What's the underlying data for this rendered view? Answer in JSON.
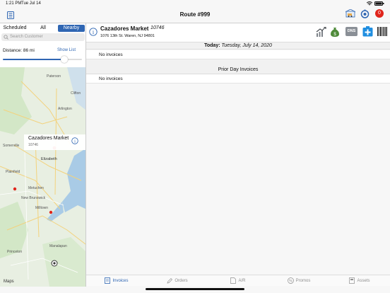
{
  "status": {
    "time": "1:21 PM",
    "date": "Tue Jul 14"
  },
  "navbar": {
    "title": "Route #999",
    "badge_count": "0"
  },
  "left": {
    "segments": [
      "Scheduled",
      "All",
      "Nearby"
    ],
    "active_segment": "Nearby",
    "search_placeholder": "Search Customer",
    "distance_label": "Distance: 86 mi",
    "show_list": "Show List",
    "slider_fraction": 0.78,
    "map": {
      "cities": [
        "Paterson",
        "Clifton",
        "Arlington",
        "Elizabeth",
        "Plainfield",
        "Metuchen",
        "New Brunswick",
        "Milltown",
        "Manalapan",
        "Princeton",
        "Somerville"
      ],
      "callout_title": "Cazadores Market",
      "callout_sub": "10746",
      "brand": "Maps"
    }
  },
  "customer": {
    "name": "Cazadores Market",
    "number": "10746",
    "address": "1076  13th St. Waren, NJ 94801",
    "dns_label": "DNS"
  },
  "today": {
    "label": "Today:",
    "date": "Tuesday, July 14, 2020",
    "empty": "No invoices"
  },
  "prior": {
    "label": "Prior Day Invoices",
    "empty": "No invoices"
  },
  "tabs": [
    {
      "label": "Invoices",
      "icon": "invoice-icon",
      "active": true
    },
    {
      "label": "Orders",
      "icon": "pencil-icon",
      "active": false
    },
    {
      "label": "A/R",
      "icon": "ar-icon",
      "active": false
    },
    {
      "label": "Promos",
      "icon": "percent-icon",
      "active": false
    },
    {
      "label": "Assets",
      "icon": "assets-icon",
      "active": false
    }
  ],
  "colors": {
    "accent": "#2f66b3",
    "badge": "#e0241b",
    "dns": "#8a8f96",
    "add_blue": "#1f8ee0"
  }
}
